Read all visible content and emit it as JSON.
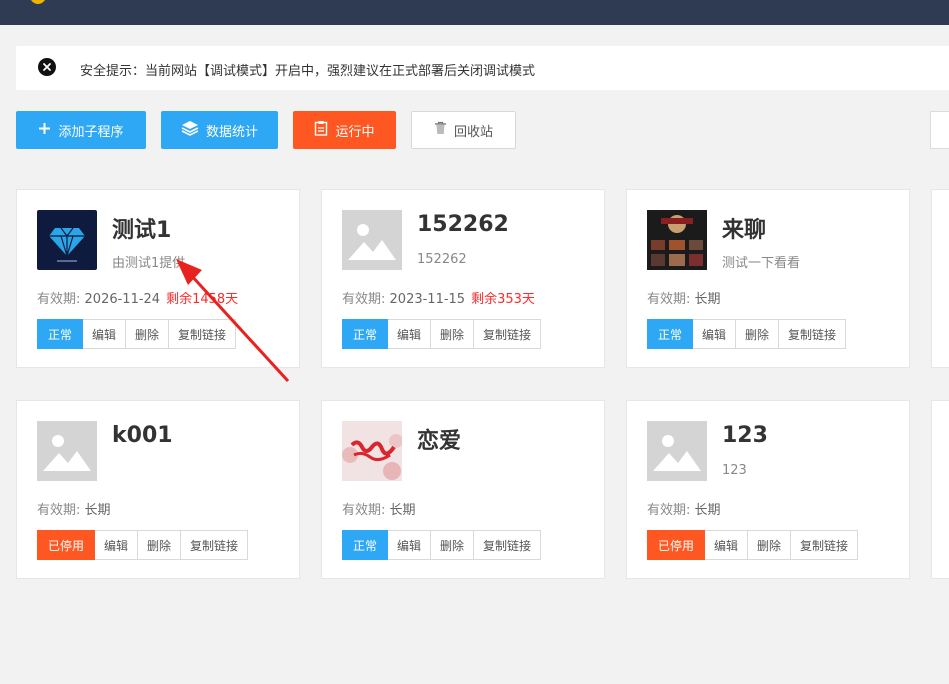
{
  "notice": {
    "text": "安全提示：当前网站【调试模式】开启中，强烈建议在正式部署后关闭调试模式"
  },
  "toolbar": {
    "add_label": "添加子程序",
    "stats_label": "数据统计",
    "running_label": "运行中",
    "recycle_label": "回收站"
  },
  "validity_label": "有效期:",
  "actions": {
    "edit": "编辑",
    "delete": "删除",
    "copy_link": "复制链接"
  },
  "cards": [
    {
      "name": "测试1",
      "desc": "由测试1提供",
      "validity": "2026-11-24",
      "remaining": "剩余1458天",
      "status": "正常",
      "status_color": "#2ea7f5",
      "image": "diamond-logo"
    },
    {
      "name": "152262",
      "desc": "152262",
      "validity": "2023-11-15",
      "remaining": "剩余353天",
      "status": "正常",
      "status_color": "#2ea7f5",
      "image": "placeholder"
    },
    {
      "name": "来聊",
      "desc": "测试一下看看",
      "validity": "长期",
      "remaining": "",
      "status": "正常",
      "status_color": "#2ea7f5",
      "image": "photo-collage"
    },
    {
      "name": "k001",
      "desc": "",
      "validity": "长期",
      "remaining": "",
      "status": "已停用",
      "status_color": "#ff5722",
      "image": "placeholder"
    },
    {
      "name": "恋爱",
      "desc": "",
      "validity": "长期",
      "remaining": "",
      "status": "正常",
      "status_color": "#2ea7f5",
      "image": "love-logo"
    },
    {
      "name": "123",
      "desc": "123",
      "validity": "长期",
      "remaining": "",
      "status": "已停用",
      "status_color": "#ff5722",
      "image": "placeholder"
    }
  ],
  "colors": {
    "header": "#2f3b52",
    "primary": "#2ea7f5",
    "warn": "#ff5722",
    "danger_text": "#ff2b2b",
    "annotation_arrow": "#e8231f"
  }
}
